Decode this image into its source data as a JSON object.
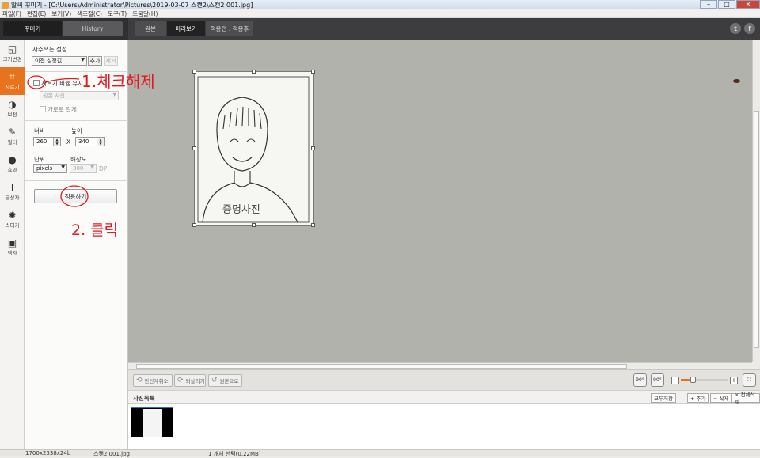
{
  "window": {
    "title": "알씨 꾸미기 - [C:\\Users\\Administrator\\Pictures\\2019-03-07 스캔2\\스캔2 001.jpg]",
    "min": "–",
    "max": "□",
    "close": "✕"
  },
  "menu": [
    "파일(F)",
    "편집(E)",
    "보기(V)",
    "색조절(C)",
    "도구(T)",
    "도움말(H)"
  ],
  "top_tabs": {
    "decorate": "꾸미기",
    "history": "History"
  },
  "view_tabs": {
    "original": "원본",
    "preview": "미리보기",
    "after": "적용전 : 적용후"
  },
  "social": {
    "twitter": "t",
    "facebook": "f"
  },
  "tools": [
    {
      "label": "크기변경",
      "icon": "◱"
    },
    {
      "label": "자르기",
      "icon": "⌗"
    },
    {
      "label": "보정",
      "icon": "◑"
    },
    {
      "label": "필터",
      "icon": "✎"
    },
    {
      "label": "효과",
      "icon": "●"
    },
    {
      "label": "글상자",
      "icon": "T"
    },
    {
      "label": "스티커",
      "icon": "✹"
    },
    {
      "label": "액자",
      "icon": "▣"
    }
  ],
  "crop_panel": {
    "favorites_label": "자주쓰는 설정",
    "preset_value": "이전 설정값",
    "add_label": "추가",
    "remove_label": "제거",
    "keep_ratio_label": "자르기 비율 유지",
    "ratio_value": "원본 사진",
    "landscape_label": "가로로 길게",
    "width_label": "너비",
    "height_label": "높이",
    "width_value": "260",
    "height_value": "340",
    "times": "X",
    "unit_label": "단위",
    "resolution_label": "해상도",
    "unit_value": "pixels",
    "resolution_value": "300",
    "dpi": "DPI",
    "apply_label": "적용하기"
  },
  "annotations": {
    "step1": "1.체크해제",
    "step2": "2. 클릭"
  },
  "photo_caption": "증명사진",
  "bottom_toolbar": {
    "undo": "한단계취소",
    "redo": "되살리기",
    "restore": "원본으로",
    "rot_left": "90°",
    "rot_right": "90°",
    "zoom_minus": "−",
    "zoom_plus": "+"
  },
  "photo_list": {
    "title": "사진목록",
    "save_all": "모두저장",
    "add": "+ 추가",
    "delete": "− 삭제",
    "delete_all": "× 전체삭제"
  },
  "status": {
    "dimensions": "1700x2338x24b",
    "filename": "스캔2 001.jpg",
    "selection": "1 개체 선택(0.22MB)"
  },
  "colors": {
    "accent": "#e8731e",
    "annotation": "#e0191e"
  }
}
